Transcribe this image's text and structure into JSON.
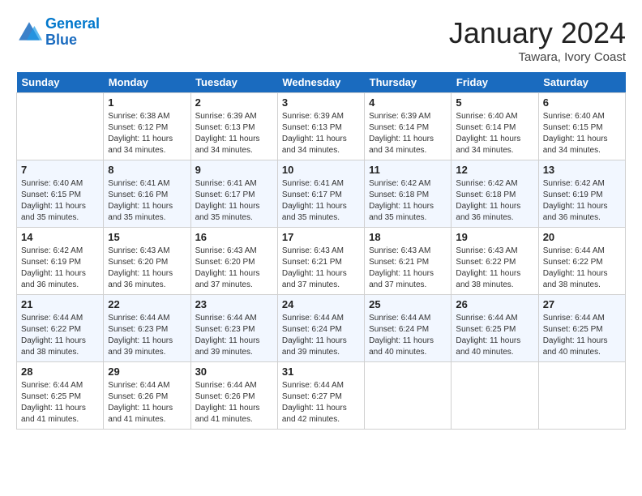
{
  "header": {
    "logo_line1": "General",
    "logo_line2": "Blue",
    "month": "January 2024",
    "location": "Tawara, Ivory Coast"
  },
  "days_of_week": [
    "Sunday",
    "Monday",
    "Tuesday",
    "Wednesday",
    "Thursday",
    "Friday",
    "Saturday"
  ],
  "weeks": [
    [
      {
        "day": "",
        "sunrise": "",
        "sunset": "",
        "daylight": ""
      },
      {
        "day": "1",
        "sunrise": "Sunrise: 6:38 AM",
        "sunset": "Sunset: 6:12 PM",
        "daylight": "Daylight: 11 hours and 34 minutes."
      },
      {
        "day": "2",
        "sunrise": "Sunrise: 6:39 AM",
        "sunset": "Sunset: 6:13 PM",
        "daylight": "Daylight: 11 hours and 34 minutes."
      },
      {
        "day": "3",
        "sunrise": "Sunrise: 6:39 AM",
        "sunset": "Sunset: 6:13 PM",
        "daylight": "Daylight: 11 hours and 34 minutes."
      },
      {
        "day": "4",
        "sunrise": "Sunrise: 6:39 AM",
        "sunset": "Sunset: 6:14 PM",
        "daylight": "Daylight: 11 hours and 34 minutes."
      },
      {
        "day": "5",
        "sunrise": "Sunrise: 6:40 AM",
        "sunset": "Sunset: 6:14 PM",
        "daylight": "Daylight: 11 hours and 34 minutes."
      },
      {
        "day": "6",
        "sunrise": "Sunrise: 6:40 AM",
        "sunset": "Sunset: 6:15 PM",
        "daylight": "Daylight: 11 hours and 34 minutes."
      }
    ],
    [
      {
        "day": "7",
        "sunrise": "Sunrise: 6:40 AM",
        "sunset": "Sunset: 6:15 PM",
        "daylight": "Daylight: 11 hours and 35 minutes."
      },
      {
        "day": "8",
        "sunrise": "Sunrise: 6:41 AM",
        "sunset": "Sunset: 6:16 PM",
        "daylight": "Daylight: 11 hours and 35 minutes."
      },
      {
        "day": "9",
        "sunrise": "Sunrise: 6:41 AM",
        "sunset": "Sunset: 6:17 PM",
        "daylight": "Daylight: 11 hours and 35 minutes."
      },
      {
        "day": "10",
        "sunrise": "Sunrise: 6:41 AM",
        "sunset": "Sunset: 6:17 PM",
        "daylight": "Daylight: 11 hours and 35 minutes."
      },
      {
        "day": "11",
        "sunrise": "Sunrise: 6:42 AM",
        "sunset": "Sunset: 6:18 PM",
        "daylight": "Daylight: 11 hours and 35 minutes."
      },
      {
        "day": "12",
        "sunrise": "Sunrise: 6:42 AM",
        "sunset": "Sunset: 6:18 PM",
        "daylight": "Daylight: 11 hours and 36 minutes."
      },
      {
        "day": "13",
        "sunrise": "Sunrise: 6:42 AM",
        "sunset": "Sunset: 6:19 PM",
        "daylight": "Daylight: 11 hours and 36 minutes."
      }
    ],
    [
      {
        "day": "14",
        "sunrise": "Sunrise: 6:42 AM",
        "sunset": "Sunset: 6:19 PM",
        "daylight": "Daylight: 11 hours and 36 minutes."
      },
      {
        "day": "15",
        "sunrise": "Sunrise: 6:43 AM",
        "sunset": "Sunset: 6:20 PM",
        "daylight": "Daylight: 11 hours and 36 minutes."
      },
      {
        "day": "16",
        "sunrise": "Sunrise: 6:43 AM",
        "sunset": "Sunset: 6:20 PM",
        "daylight": "Daylight: 11 hours and 37 minutes."
      },
      {
        "day": "17",
        "sunrise": "Sunrise: 6:43 AM",
        "sunset": "Sunset: 6:21 PM",
        "daylight": "Daylight: 11 hours and 37 minutes."
      },
      {
        "day": "18",
        "sunrise": "Sunrise: 6:43 AM",
        "sunset": "Sunset: 6:21 PM",
        "daylight": "Daylight: 11 hours and 37 minutes."
      },
      {
        "day": "19",
        "sunrise": "Sunrise: 6:43 AM",
        "sunset": "Sunset: 6:22 PM",
        "daylight": "Daylight: 11 hours and 38 minutes."
      },
      {
        "day": "20",
        "sunrise": "Sunrise: 6:44 AM",
        "sunset": "Sunset: 6:22 PM",
        "daylight": "Daylight: 11 hours and 38 minutes."
      }
    ],
    [
      {
        "day": "21",
        "sunrise": "Sunrise: 6:44 AM",
        "sunset": "Sunset: 6:22 PM",
        "daylight": "Daylight: 11 hours and 38 minutes."
      },
      {
        "day": "22",
        "sunrise": "Sunrise: 6:44 AM",
        "sunset": "Sunset: 6:23 PM",
        "daylight": "Daylight: 11 hours and 39 minutes."
      },
      {
        "day": "23",
        "sunrise": "Sunrise: 6:44 AM",
        "sunset": "Sunset: 6:23 PM",
        "daylight": "Daylight: 11 hours and 39 minutes."
      },
      {
        "day": "24",
        "sunrise": "Sunrise: 6:44 AM",
        "sunset": "Sunset: 6:24 PM",
        "daylight": "Daylight: 11 hours and 39 minutes."
      },
      {
        "day": "25",
        "sunrise": "Sunrise: 6:44 AM",
        "sunset": "Sunset: 6:24 PM",
        "daylight": "Daylight: 11 hours and 40 minutes."
      },
      {
        "day": "26",
        "sunrise": "Sunrise: 6:44 AM",
        "sunset": "Sunset: 6:25 PM",
        "daylight": "Daylight: 11 hours and 40 minutes."
      },
      {
        "day": "27",
        "sunrise": "Sunrise: 6:44 AM",
        "sunset": "Sunset: 6:25 PM",
        "daylight": "Daylight: 11 hours and 40 minutes."
      }
    ],
    [
      {
        "day": "28",
        "sunrise": "Sunrise: 6:44 AM",
        "sunset": "Sunset: 6:25 PM",
        "daylight": "Daylight: 11 hours and 41 minutes."
      },
      {
        "day": "29",
        "sunrise": "Sunrise: 6:44 AM",
        "sunset": "Sunset: 6:26 PM",
        "daylight": "Daylight: 11 hours and 41 minutes."
      },
      {
        "day": "30",
        "sunrise": "Sunrise: 6:44 AM",
        "sunset": "Sunset: 6:26 PM",
        "daylight": "Daylight: 11 hours and 41 minutes."
      },
      {
        "day": "31",
        "sunrise": "Sunrise: 6:44 AM",
        "sunset": "Sunset: 6:27 PM",
        "daylight": "Daylight: 11 hours and 42 minutes."
      },
      {
        "day": "",
        "sunrise": "",
        "sunset": "",
        "daylight": ""
      },
      {
        "day": "",
        "sunrise": "",
        "sunset": "",
        "daylight": ""
      },
      {
        "day": "",
        "sunrise": "",
        "sunset": "",
        "daylight": ""
      }
    ]
  ]
}
